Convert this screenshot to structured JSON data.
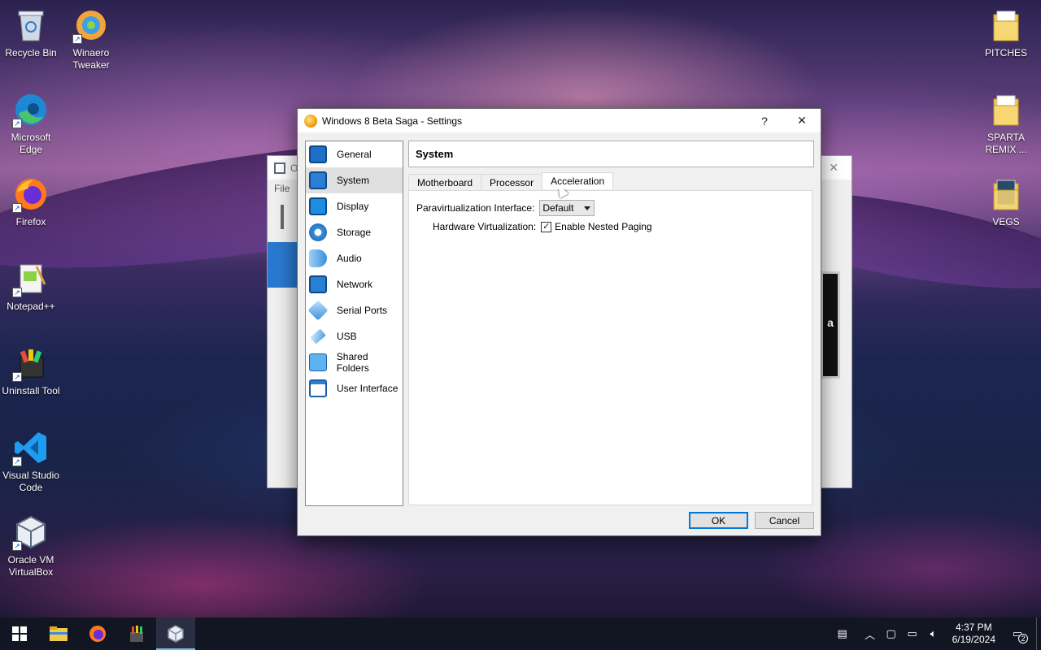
{
  "desktop": {
    "left_icons": [
      {
        "label": "Recycle Bin",
        "icon": "recycle-bin-icon"
      },
      {
        "label": "Winaero Tweaker",
        "icon": "winaero-tweaker-icon"
      },
      {
        "label": "Microsoft Edge",
        "icon": "edge-icon"
      },
      {
        "label": "Firefox",
        "icon": "firefox-icon"
      },
      {
        "label": "Notepad++",
        "icon": "notepadpp-icon"
      },
      {
        "label": "Uninstall Tool",
        "icon": "uninstall-tool-icon"
      },
      {
        "label": "Visual Studio Code",
        "icon": "vscode-icon"
      },
      {
        "label": "Oracle VM VirtualBox",
        "icon": "virtualbox-icon"
      }
    ],
    "right_icons": [
      {
        "label": "PITCHES",
        "icon": "folder-icon"
      },
      {
        "label": "SPARTA REMIX ...",
        "icon": "folder-icon"
      },
      {
        "label": "VEGS",
        "icon": "folder-icon"
      }
    ]
  },
  "background_window": {
    "title_partial": "O",
    "menu_file": "File",
    "preview_partial": "a"
  },
  "dialog": {
    "title": "Windows 8 Beta Saga - Settings",
    "help_label": "?",
    "close_label": "✕",
    "nav_items": [
      {
        "label": "General",
        "icon": "general-icon",
        "selected": false
      },
      {
        "label": "System",
        "icon": "system-icon",
        "selected": true
      },
      {
        "label": "Display",
        "icon": "display-icon",
        "selected": false
      },
      {
        "label": "Storage",
        "icon": "storage-icon",
        "selected": false
      },
      {
        "label": "Audio",
        "icon": "audio-icon",
        "selected": false
      },
      {
        "label": "Network",
        "icon": "network-icon",
        "selected": false
      },
      {
        "label": "Serial Ports",
        "icon": "serial-ports-icon",
        "selected": false
      },
      {
        "label": "USB",
        "icon": "usb-icon",
        "selected": false
      },
      {
        "label": "Shared Folders",
        "icon": "shared-folders-icon",
        "selected": false
      },
      {
        "label": "User Interface",
        "icon": "user-interface-icon",
        "selected": false
      }
    ],
    "section_title": "System",
    "tabs": [
      {
        "label": "Motherboard",
        "active": false
      },
      {
        "label": "Processor",
        "active": false
      },
      {
        "label": "Acceleration",
        "active": true
      }
    ],
    "acceleration": {
      "paravirt_label": "Paravirtualization Interface:",
      "paravirt_value": "Default",
      "hwvirt_label": "Hardware Virtualization:",
      "nested_paging_label": "Enable Nested Paging",
      "nested_paging_checked": true,
      "check_mark": "✓"
    },
    "ok_label": "OK",
    "cancel_label": "Cancel"
  },
  "taskbar": {
    "apps": [
      {
        "name": "start",
        "icon": "windows-start-icon"
      },
      {
        "name": "explorer",
        "icon": "file-explorer-icon"
      },
      {
        "name": "firefox",
        "icon": "firefox-icon"
      },
      {
        "name": "uninstall-tool",
        "icon": "uninstall-tool-icon"
      },
      {
        "name": "virtualbox",
        "icon": "virtualbox-icon",
        "active": true
      }
    ],
    "time": "4:37 PM",
    "date": "6/19/2024",
    "notification_count": "2"
  },
  "colors": {
    "accent": "#0078d7",
    "taskbar": "#121522"
  }
}
